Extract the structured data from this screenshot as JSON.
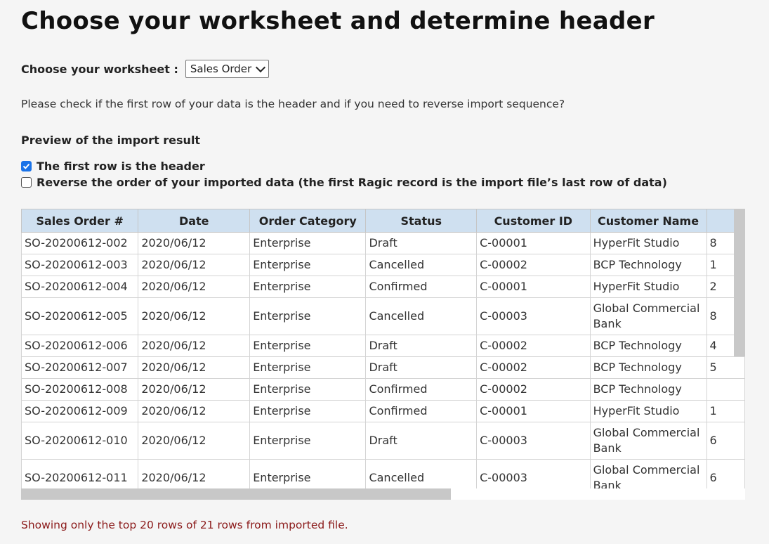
{
  "page_title": "Choose your worksheet and determine header",
  "worksheet": {
    "label": "Choose your worksheet :",
    "selected": "Sales Order"
  },
  "instruction": "Please check if the first row of your data is the header and if you need to reverse import sequence?",
  "preview_title": "Preview of the import result",
  "options": {
    "first_row_header": {
      "label": "The first row is the header",
      "checked": true
    },
    "reverse_order": {
      "label": "Reverse the order of your imported data (the first Ragic record is the import file’s last row of data)",
      "checked": false
    }
  },
  "table": {
    "columns": [
      "Sales Order #",
      "Date",
      "Order Category",
      "Status",
      "Customer ID",
      "Customer Name"
    ],
    "rows": [
      {
        "cells": [
          "SO-20200612-002",
          "2020/06/12",
          "Enterprise",
          "Draft",
          "C-00001",
          "HyperFit Studio"
        ],
        "partial": "8"
      },
      {
        "cells": [
          "SO-20200612-003",
          "2020/06/12",
          "Enterprise",
          "Cancelled",
          "C-00002",
          "BCP Technology"
        ],
        "partial": "1"
      },
      {
        "cells": [
          "SO-20200612-004",
          "2020/06/12",
          "Enterprise",
          "Confirmed",
          "C-00001",
          "HyperFit Studio"
        ],
        "partial": "2"
      },
      {
        "cells": [
          "SO-20200612-005",
          "2020/06/12",
          "Enterprise",
          "Cancelled",
          "C-00003",
          "Global Commercial Bank"
        ],
        "partial": "8"
      },
      {
        "cells": [
          "SO-20200612-006",
          "2020/06/12",
          "Enterprise",
          "Draft",
          "C-00002",
          "BCP Technology"
        ],
        "partial": "4"
      },
      {
        "cells": [
          "SO-20200612-007",
          "2020/06/12",
          "Enterprise",
          "Draft",
          "C-00002",
          "BCP Technology"
        ],
        "partial": "5"
      },
      {
        "cells": [
          "SO-20200612-008",
          "2020/06/12",
          "Enterprise",
          "Confirmed",
          "C-00002",
          "BCP Technology"
        ],
        "partial": ""
      },
      {
        "cells": [
          "SO-20200612-009",
          "2020/06/12",
          "Enterprise",
          "Confirmed",
          "C-00001",
          "HyperFit Studio"
        ],
        "partial": "1"
      },
      {
        "cells": [
          "SO-20200612-010",
          "2020/06/12",
          "Enterprise",
          "Draft",
          "C-00003",
          "Global Commercial Bank"
        ],
        "partial": "6"
      },
      {
        "cells": [
          "SO-20200612-011",
          "2020/06/12",
          "Enterprise",
          "Cancelled",
          "C-00003",
          "Global Commercial Bank"
        ],
        "partial": "6"
      }
    ]
  },
  "footer_note": "Showing only the top 20 rows of 21 rows from imported file.",
  "colors": {
    "header_bg": "#cfe0f0",
    "checkbox_checked": "#1a73e8",
    "footer_text": "#8b1a1a"
  }
}
